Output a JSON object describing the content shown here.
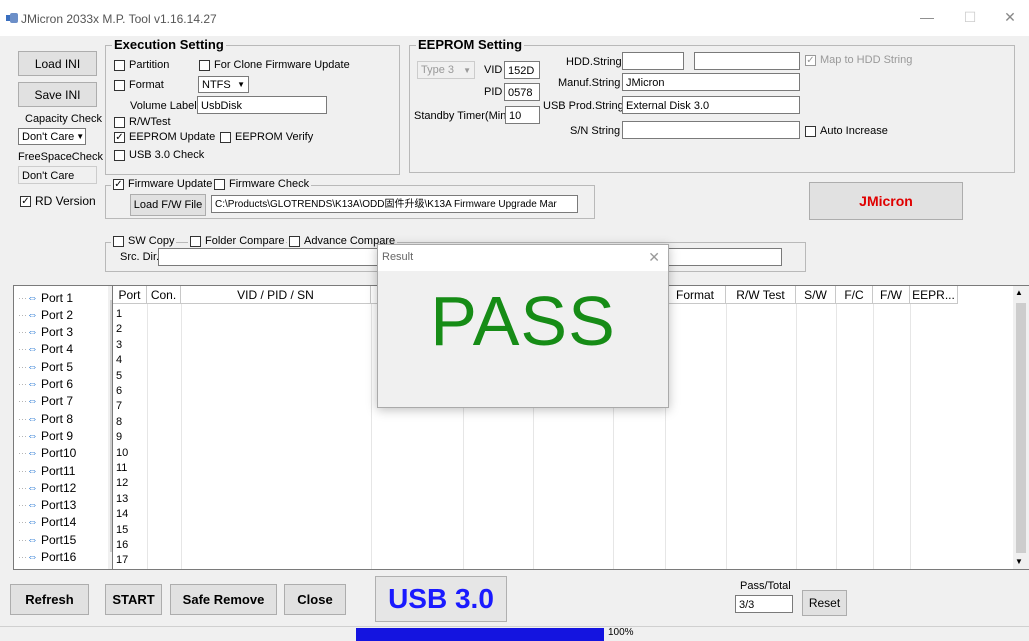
{
  "window": {
    "title": "JMicron 2033x M.P. Tool v1.16.14.27",
    "minimize": "—",
    "maximize": "☐",
    "close": "✕"
  },
  "left_panel": {
    "load_ini": "Load INI",
    "save_ini": "Save INI",
    "capacity_check_label": "Capacity Check",
    "capacity_check_value": "Don't Care",
    "free_space_label": "FreeSpaceCheck",
    "free_space_value": "Don't Care",
    "rd_version": "RD Version"
  },
  "execution": {
    "title": "Execution Setting",
    "partition": "Partition",
    "clone_fw": "For Clone Firmware Update",
    "format": "Format",
    "format_value": "NTFS",
    "volume_label": "Volume Label",
    "volume_value": "UsbDisk",
    "rw_test": "R/WTest",
    "eeprom_update": "EEPROM Update",
    "eeprom_verify": "EEPROM Verify",
    "usb30_check": "USB 3.0 Check"
  },
  "eeprom": {
    "title": "EEPROM Setting",
    "type_value": "Type 3",
    "vid_label": "VID",
    "vid_value": "152D",
    "pid_label": "PID",
    "pid_value": "0578",
    "standby_label": "Standby Timer(Min.)",
    "standby_value": "10",
    "hdd_string_label": "HDD.String",
    "hdd_string_value": "",
    "map_to_hdd": "Map to HDD String",
    "manuf_label": "Manuf.String",
    "manuf_value": "JMicron",
    "usb_prod_label": "USB Prod.String",
    "usb_prod_value": "External Disk 3.0",
    "sn_label": "S/N String",
    "sn_value": "",
    "auto_increase": "Auto Increase"
  },
  "firmware": {
    "fw_update": "Firmware Update",
    "fw_check": "Firmware Check",
    "load_fw": "Load F/W File",
    "fw_path": "C:\\Products\\GLOTRENDS\\K13A\\ODD固件升级\\K13A Firmware Upgrade Mar"
  },
  "brand_button": "JMicron",
  "compare": {
    "sw_copy": "SW Copy",
    "folder_compare": "Folder Compare",
    "advance_compare": "Advance Compare",
    "src_dir_label": "Src. Dir."
  },
  "ports": [
    "Port 1",
    "Port 2",
    "Port 3",
    "Port 4",
    "Port 5",
    "Port 6",
    "Port 7",
    "Port 8",
    "Port 9",
    "Port10",
    "Port11",
    "Port12",
    "Port13",
    "Port14",
    "Port15",
    "Port16",
    "Port17"
  ],
  "grid": {
    "columns": [
      "Port",
      "Con.",
      "VID / PID / SN",
      "Format",
      "R/W Test",
      "S/W",
      "F/C",
      "F/W",
      "EEPR..."
    ],
    "rows": [
      "1",
      "2",
      "3",
      "4",
      "5",
      "6",
      "7",
      "8",
      "9",
      "10",
      "11",
      "12",
      "13",
      "14",
      "15",
      "16",
      "17"
    ]
  },
  "result_dialog": {
    "title": "Result",
    "close": "✕",
    "message": "PASS"
  },
  "bottom": {
    "refresh": "Refresh",
    "start": "START",
    "safe_remove": "Safe Remove",
    "close": "Close",
    "usb_label": "USB 3.0",
    "pass_total_label": "Pass/Total",
    "pass_total_value": "3/3",
    "reset": "Reset",
    "progress_text": "100%",
    "progress_fraction": 1.0
  }
}
